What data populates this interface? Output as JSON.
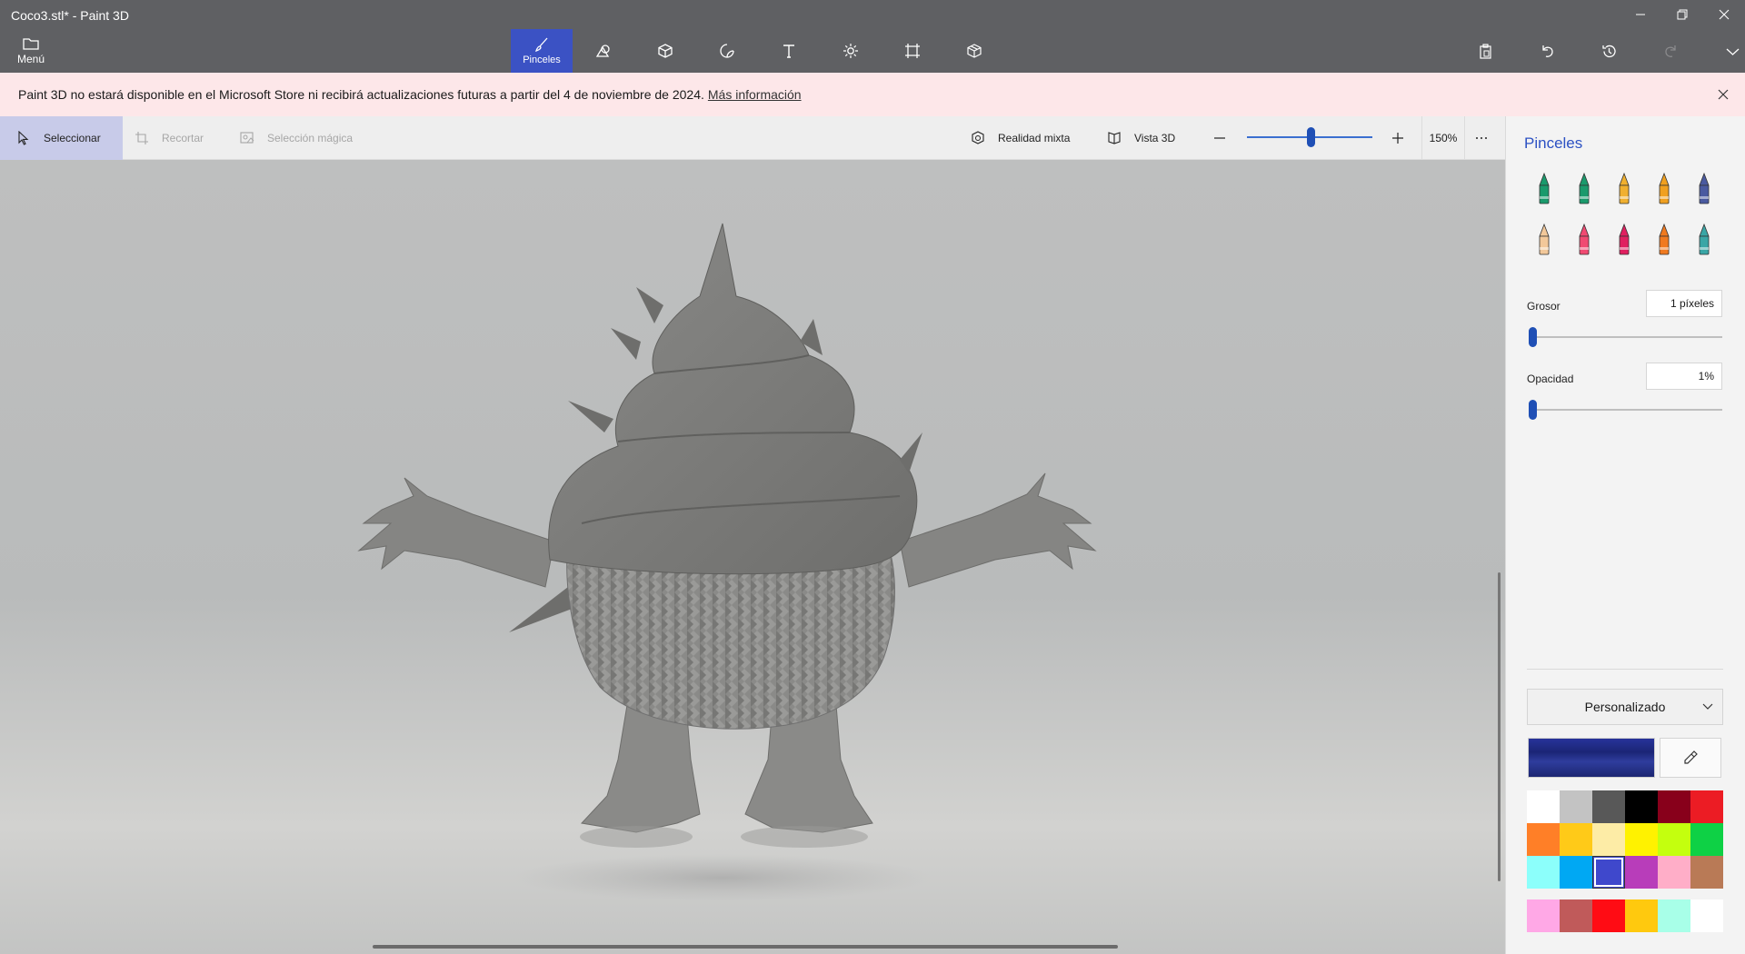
{
  "window": {
    "title": "Coco3.stl* - Paint 3D",
    "menu_label": "Menú"
  },
  "toolbar": {
    "tools": [
      {
        "label": "Pinceles",
        "icon": "brush-icon",
        "active": true
      },
      {
        "label": "",
        "icon": "2d-shapes-icon"
      },
      {
        "label": "",
        "icon": "3d-shapes-icon"
      },
      {
        "label": "",
        "icon": "stickers-icon"
      },
      {
        "label": "",
        "icon": "text-icon"
      },
      {
        "label": "",
        "icon": "effects-icon"
      },
      {
        "label": "",
        "icon": "canvas-icon"
      },
      {
        "label": "",
        "icon": "3d-library-icon"
      }
    ],
    "right_actions": [
      "paste-icon",
      "undo-icon",
      "history-icon",
      "redo-icon",
      "expand-icon"
    ]
  },
  "notice": {
    "text": "Paint 3D no estará disponible en el Microsoft Store ni recibirá actualizaciones futuras a partir del 4 de noviembre de 2024.",
    "link": "Más información"
  },
  "subbar": {
    "select": "Seleccionar",
    "crop": "Recortar",
    "magic_select": "Selección mágica",
    "mixed_reality": "Realidad mixta",
    "view_3d": "Vista 3D",
    "zoom": "150%"
  },
  "panel": {
    "title": "Pinceles",
    "brushes": [
      {
        "name": "marker-brush-icon",
        "color": "#1a9a6c"
      },
      {
        "name": "calligraphy-pen-icon",
        "color": "#1a9a6c"
      },
      {
        "name": "oil-brush-icon",
        "color": "#f0b030"
      },
      {
        "name": "watercolor-brush-icon",
        "color": "#f0a020"
      },
      {
        "name": "pixel-pen-icon",
        "color": "#4a5aa0"
      },
      {
        "name": "pencil-icon",
        "color": "#f2c89a"
      },
      {
        "name": "eraser-icon",
        "color": "#f04a72"
      },
      {
        "name": "crayon-icon",
        "color": "#e02060"
      },
      {
        "name": "spray-can-icon",
        "color": "#f07a20"
      },
      {
        "name": "fill-bucket-icon",
        "color": "#3aa6a6"
      }
    ],
    "thickness_label": "Grosor",
    "thickness_value": "1 píxeles",
    "thickness_level": 0.01,
    "opacity_label": "Opacidad",
    "opacity_value": "1%",
    "opacity_level": 0.01,
    "palette_mode": "Personalizado",
    "current_color": "#1f2a80",
    "swatches": [
      "#ffffff",
      "#c3c3c3",
      "#585858",
      "#000000",
      "#88001b",
      "#ec1c24",
      "#ff7f27",
      "#ffca18",
      "#fdeca6",
      "#fff200",
      "#c4ff0e",
      "#0ed145",
      "#8cfffb",
      "#00a8f3",
      "#3f48cc",
      "#b83dba",
      "#ffaec8",
      "#b97a56"
    ],
    "selected_swatch": 14,
    "custom_swatches": [
      "#ffa8e6",
      "#c05a5a",
      "#ff0c14",
      "#ffc90e",
      "#a8ffe8",
      "#ffffff"
    ]
  }
}
